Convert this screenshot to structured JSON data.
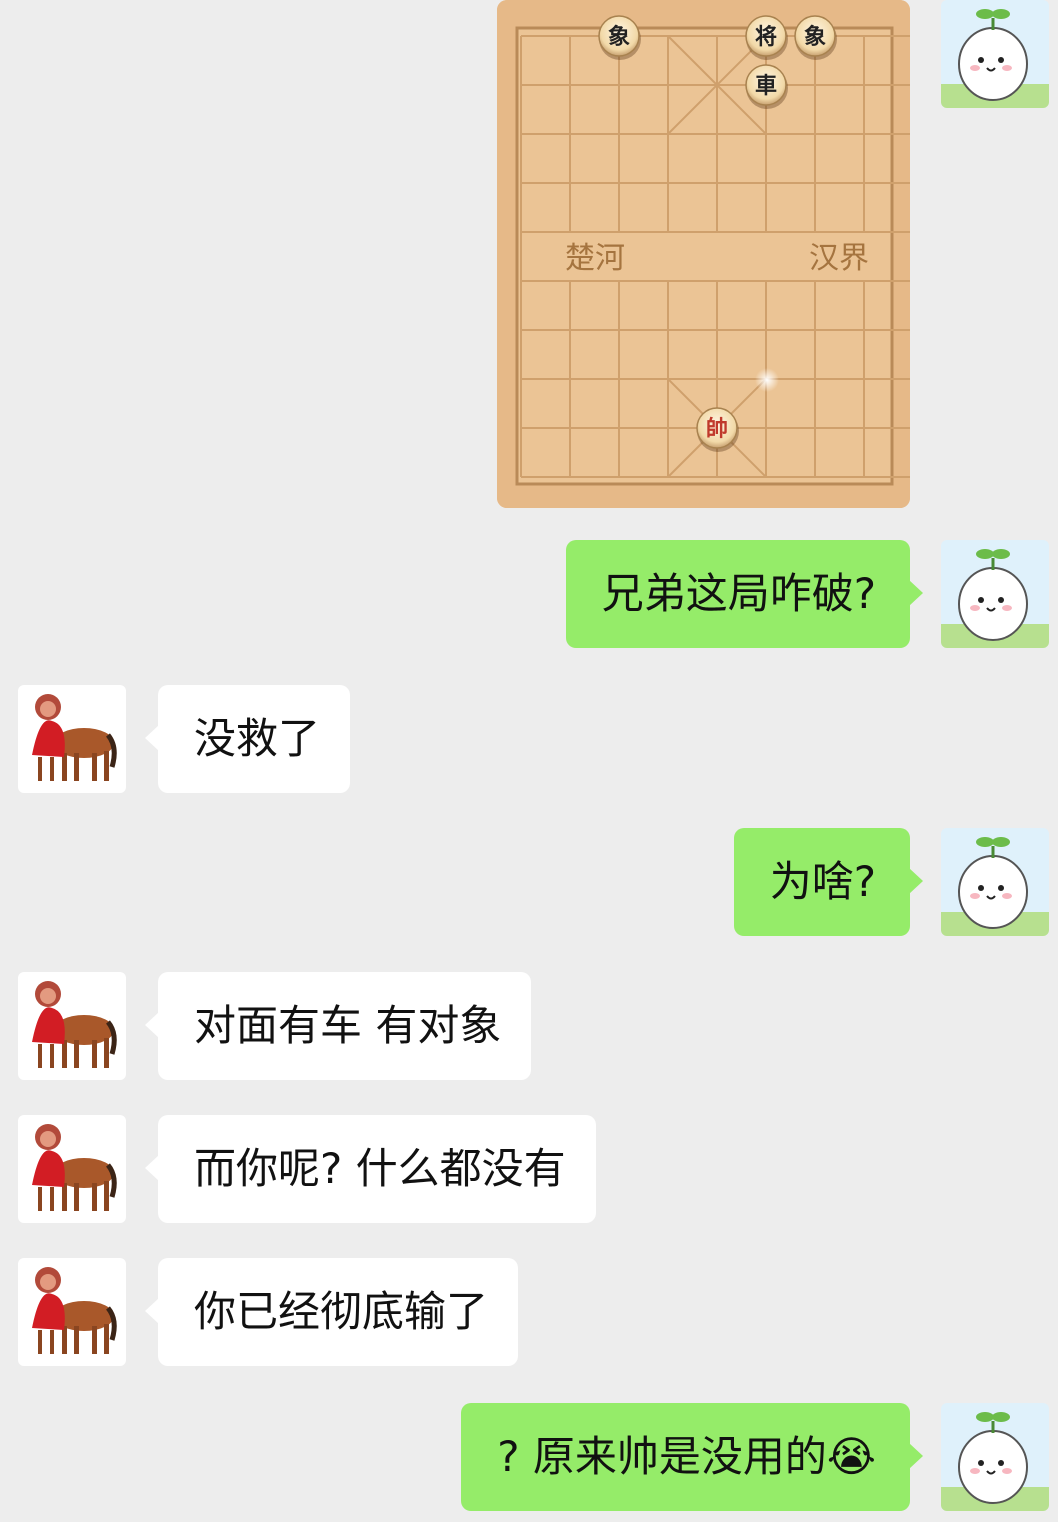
{
  "chat": {
    "board_image": {
      "river_left": "楚河",
      "river_right": "汉界",
      "pieces": [
        {
          "label": "象",
          "side": "black",
          "file": 2,
          "rank": 0
        },
        {
          "label": "将",
          "side": "black",
          "file": 5,
          "rank": 0
        },
        {
          "label": "象",
          "side": "black",
          "file": 6,
          "rank": 0
        },
        {
          "label": "車",
          "side": "black",
          "file": 5,
          "rank": 1
        },
        {
          "label": "帥",
          "side": "red",
          "file": 4,
          "rank": 8
        }
      ]
    },
    "messages": [
      {
        "sender": "me",
        "text": "兄弟这局咋破?"
      },
      {
        "sender": "them",
        "text": "没救了"
      },
      {
        "sender": "me",
        "text": "为啥?"
      },
      {
        "sender": "them",
        "text": "对面有车 有对象"
      },
      {
        "sender": "them",
        "text": "而你呢? 什么都没有"
      },
      {
        "sender": "them",
        "text": "你已经彻底输了"
      },
      {
        "sender": "me",
        "text": "? 原来帅是没用的",
        "emoji": "😭"
      }
    ]
  },
  "colors": {
    "background": "#ededed",
    "my_bubble": "#95ec69",
    "their_bubble": "#ffffff",
    "board": "#e8bd8c",
    "board_lines": "#c89a68",
    "red_piece_text": "#c0392b",
    "black_piece_text": "#222222"
  },
  "icons": {
    "my_avatar": "sprout-ghost-avatar-icon",
    "their_avatar": "horse-avatar-icon"
  }
}
